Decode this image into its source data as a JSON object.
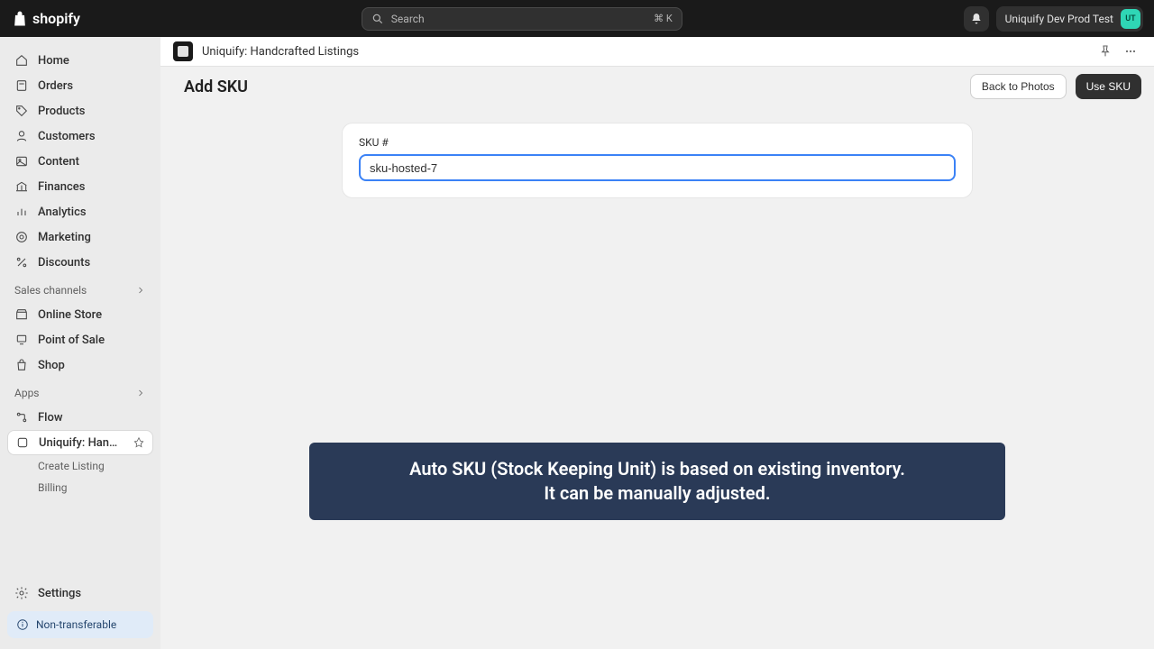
{
  "topbar": {
    "logo_text": "shopify",
    "search_placeholder": "Search",
    "search_shortcut": "⌘ K",
    "user_label": "Uniquify Dev Prod Test",
    "user_initials": "UT"
  },
  "sidebar": {
    "items": [
      {
        "label": "Home"
      },
      {
        "label": "Orders"
      },
      {
        "label": "Products"
      },
      {
        "label": "Customers"
      },
      {
        "label": "Content"
      },
      {
        "label": "Finances"
      },
      {
        "label": "Analytics"
      },
      {
        "label": "Marketing"
      },
      {
        "label": "Discounts"
      }
    ],
    "sales_channels_header": "Sales channels",
    "channels": [
      {
        "label": "Online Store"
      },
      {
        "label": "Point of Sale"
      },
      {
        "label": "Shop"
      }
    ],
    "apps_header": "Apps",
    "apps": [
      {
        "label": "Flow"
      }
    ],
    "current_app": {
      "label": "Uniquify: Handcrafte...",
      "subs": [
        {
          "label": "Create Listing"
        },
        {
          "label": "Billing"
        }
      ]
    },
    "settings_label": "Settings",
    "badge_label": "Non-transferable"
  },
  "page": {
    "app_name": "Uniquify: Handcrafted Listings",
    "title": "Add SKU",
    "back_btn": "Back to Photos",
    "primary_btn": "Use SKU",
    "sku_label": "SKU #",
    "sku_value": "sku-hosted-7",
    "tooltip_line1": "Auto SKU (Stock Keeping Unit) is based on existing inventory.",
    "tooltip_line2": "It can be manually adjusted."
  }
}
